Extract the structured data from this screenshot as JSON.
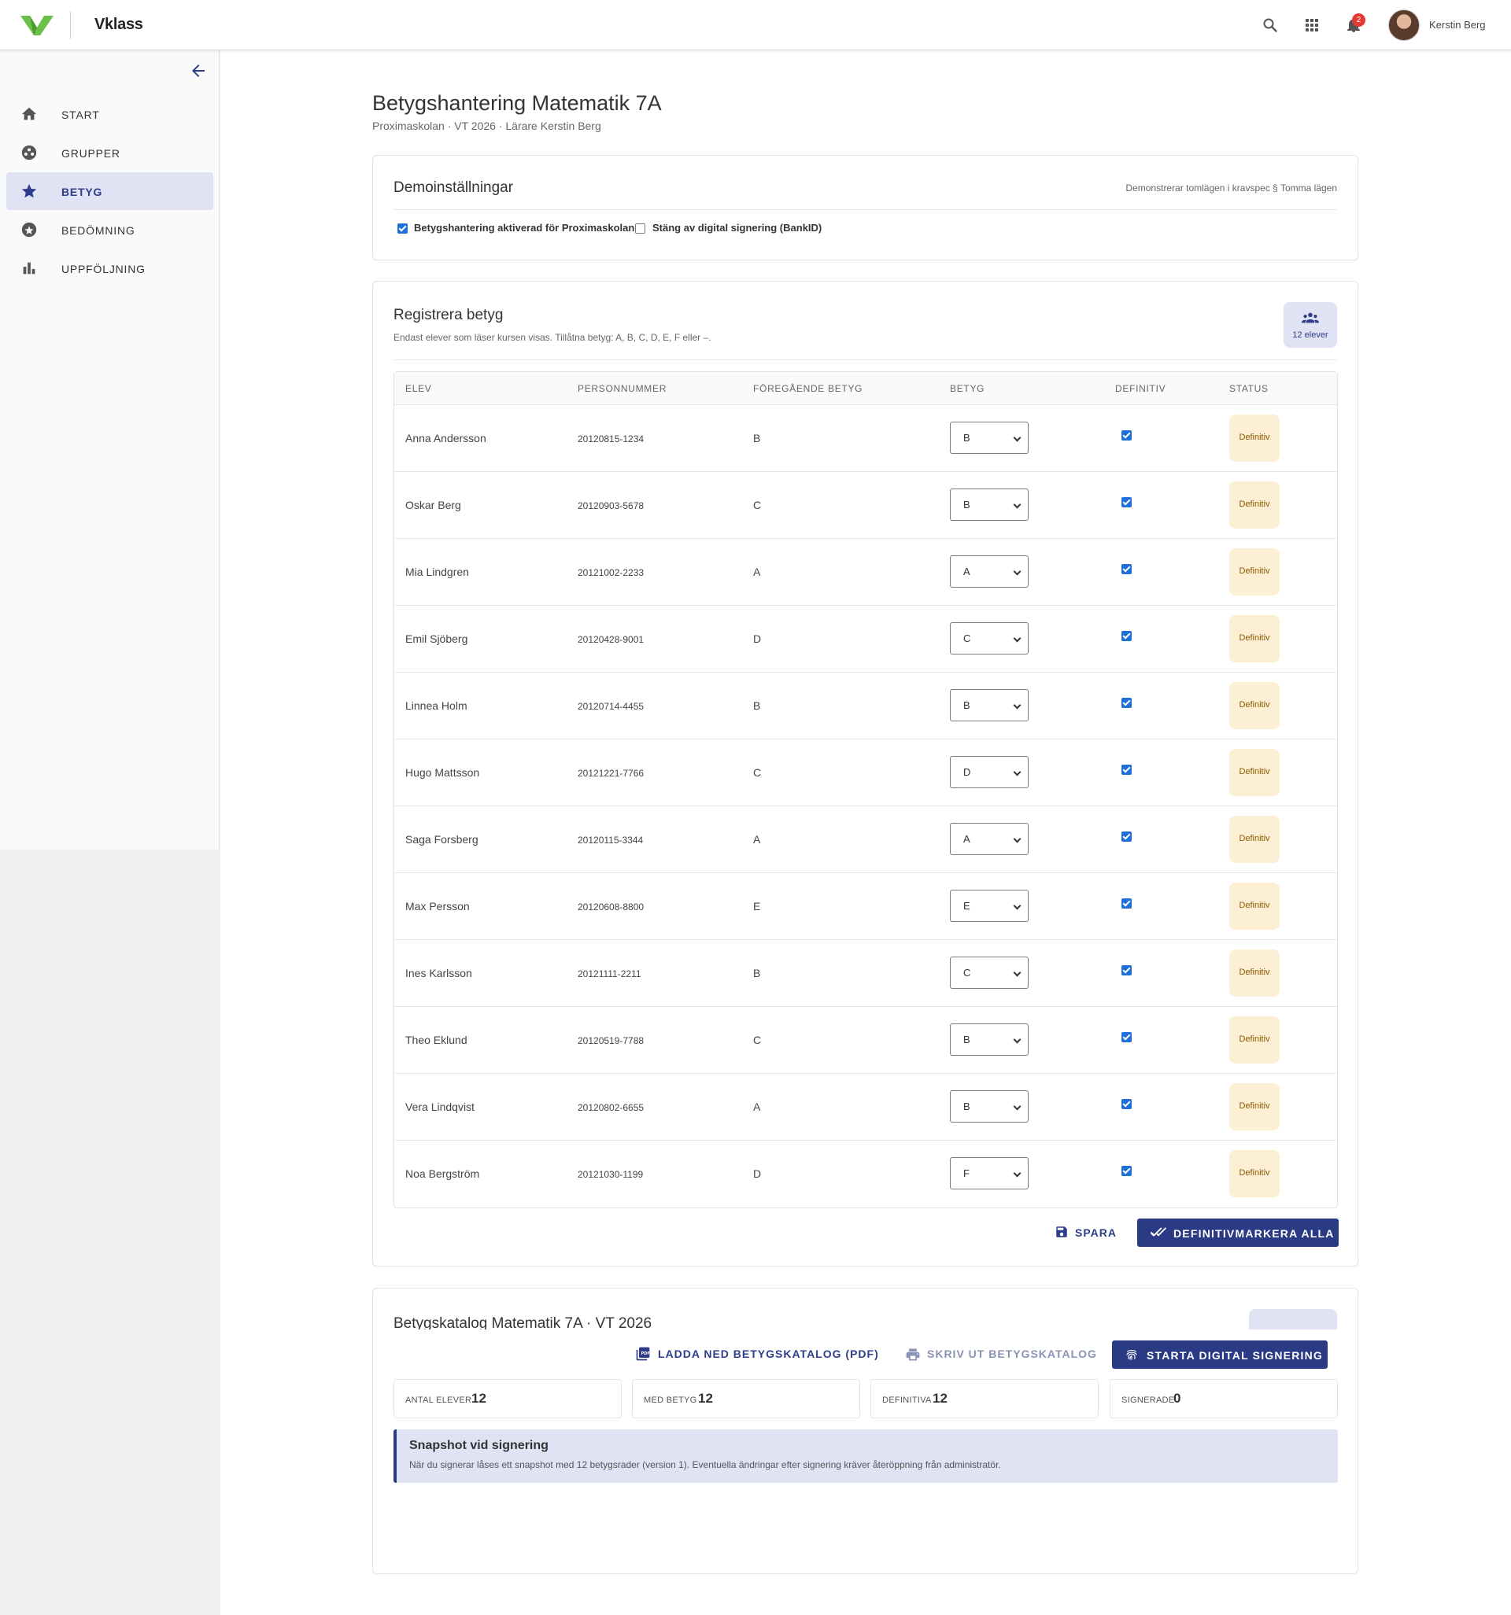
{
  "app": {
    "brand": "Vklass",
    "notifications": "2",
    "user_name": "Kerstin Berg"
  },
  "sidebar": {
    "items": [
      {
        "label": "START",
        "icon": "home-icon"
      },
      {
        "label": "GRUPPER",
        "icon": "groups-icon"
      },
      {
        "label": "BETYG",
        "icon": "star-icon",
        "active": true
      },
      {
        "label": "BEDÖMNING",
        "icon": "stars-circle-icon"
      },
      {
        "label": "UPPFÖLJNING",
        "icon": "bar-chart-icon"
      }
    ]
  },
  "page": {
    "title": "Betygshantering Matematik 7A",
    "subtitle": "Proximaskolan · VT 2026 · Lärare Kerstin Berg"
  },
  "demo": {
    "title": "Demoinställningar",
    "note": "Demonstrerar tomlägen i kravspec § Tomma lägen",
    "opt1": "Betygshantering aktiverad för Proximaskolan",
    "opt1_checked": true,
    "opt2": "Stäng av digital signering (BankID)",
    "opt2_checked": false
  },
  "register": {
    "title": "Registrera betyg",
    "description": "Endast elever som läser kursen visas. Tillåtna betyg: A, B, C, D, E, F eller –.",
    "count_label": "12 elever",
    "columns": [
      "ELEV",
      "PERSONNUMMER",
      "FÖREGÅENDE BETYG",
      "BETYG",
      "DEFINITIV",
      "STATUS"
    ],
    "rows": [
      {
        "name": "Anna Andersson",
        "pn": "20120815-1234",
        "prev": "B",
        "grade": "B",
        "final": true,
        "status": "Definitiv"
      },
      {
        "name": "Oskar Berg",
        "pn": "20120903-5678",
        "prev": "C",
        "grade": "B",
        "final": true,
        "status": "Definitiv"
      },
      {
        "name": "Mia Lindgren",
        "pn": "20121002-2233",
        "prev": "A",
        "grade": "A",
        "final": true,
        "status": "Definitiv"
      },
      {
        "name": "Emil Sjöberg",
        "pn": "20120428-9001",
        "prev": "D",
        "grade": "C",
        "final": true,
        "status": "Definitiv"
      },
      {
        "name": "Linnea Holm",
        "pn": "20120714-4455",
        "prev": "B",
        "grade": "B",
        "final": true,
        "status": "Definitiv"
      },
      {
        "name": "Hugo Mattsson",
        "pn": "20121221-7766",
        "prev": "C",
        "grade": "D",
        "final": true,
        "status": "Definitiv"
      },
      {
        "name": "Saga Forsberg",
        "pn": "20120115-3344",
        "prev": "A",
        "grade": "A",
        "final": true,
        "status": "Definitiv"
      },
      {
        "name": "Max Persson",
        "pn": "20120608-8800",
        "prev": "E",
        "grade": "E",
        "final": true,
        "status": "Definitiv"
      },
      {
        "name": "Ines Karlsson",
        "pn": "20121111-2211",
        "prev": "B",
        "grade": "C",
        "final": true,
        "status": "Definitiv"
      },
      {
        "name": "Theo Eklund",
        "pn": "20120519-7788",
        "prev": "C",
        "grade": "B",
        "final": true,
        "status": "Definitiv"
      },
      {
        "name": "Vera Lindqvist",
        "pn": "20120802-6655",
        "prev": "A",
        "grade": "B",
        "final": true,
        "status": "Definitiv"
      },
      {
        "name": "Noa Bergström",
        "pn": "20121030-1199",
        "prev": "D",
        "grade": "F",
        "final": true,
        "status": "Definitiv"
      }
    ],
    "save_label": "SPARA",
    "finalize_all_label": "DEFINITIVMARKERA ALLA"
  },
  "catalog": {
    "title": "Betygskatalog Matematik 7A · VT 2026",
    "download_label": "LADDA NED BETYGSKATALOG (PDF)",
    "print_label": "SKRIV UT BETYGSKATALOG",
    "sign_label": "STARTA DIGITAL SIGNERING",
    "stats": [
      {
        "label": "ANTAL ELEVER",
        "value": "12"
      },
      {
        "label": "MED BETYG",
        "value": "12"
      },
      {
        "label": "DEFINITIVA",
        "value": "12"
      },
      {
        "label": "SIGNERADE",
        "value": "0"
      }
    ],
    "snapshot_title": "Snapshot vid signering",
    "snapshot_desc": "När du signerar låses ett snapshot med 12 betygsrader (version 1). Eventuella ändringar efter signering kräver återöppning från administratör."
  },
  "colors": {
    "primary": "#2a3a85",
    "active_bg": "#dfe3f4",
    "status_bg": "#fdefd4",
    "logo": "#6cc04a",
    "badge": "#e53935"
  }
}
